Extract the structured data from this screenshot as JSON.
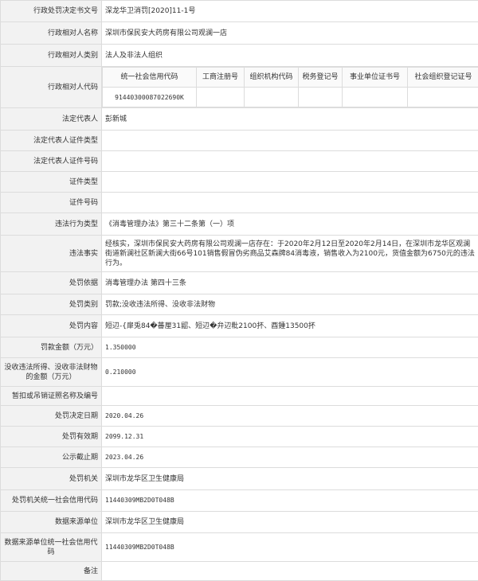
{
  "rows": {
    "decision_no": {
      "label": "行政处罚决定书文号",
      "value": "深龙华卫消罚[2020]11-1号"
    },
    "party_name": {
      "label": "行政相对人名称",
      "value": "深圳市保民安大药房有限公司观澜一店"
    },
    "party_type": {
      "label": "行政相对人类别",
      "value": "法人及非法人组织"
    },
    "party_code": {
      "label": "行政相对人代码",
      "headers": [
        "统一社会信用代码",
        "工商注册号",
        "组织机构代码",
        "税务登记号",
        "事业单位证书号",
        "社会组织登记证号"
      ],
      "values": [
        "91440300087022690K",
        "",
        "",
        "",
        "",
        ""
      ]
    },
    "legal_rep": {
      "label": "法定代表人",
      "value": "彭新城"
    },
    "legal_rep_id_type": {
      "label": "法定代表人证件类型",
      "value": ""
    },
    "legal_rep_id_no": {
      "label": "法定代表人证件号码",
      "value": ""
    },
    "id_type": {
      "label": "证件类型",
      "value": ""
    },
    "id_no": {
      "label": "证件号码",
      "value": ""
    },
    "violation_type": {
      "label": "违法行为类型",
      "value": "《消毒管理办法》第三十二条第（一）项"
    },
    "violation_facts": {
      "label": "违法事实",
      "value": "经核实，深圳市保民安大药房有限公司观澜一店存在：于2020年2月12日至2020年2月14日，在深圳市龙华区观澜街道新澜社区新澜大街66号101销售假冒伪劣商品艾森牌84消毒液，销售收入为2100元，货值金额为6750元的违法行为。"
    },
    "penalty_basis": {
      "label": "处罚依据",
      "value": "消毒管理办法 第四十三条"
    },
    "penalty_category": {
      "label": "处罚类别",
      "value": "罚款;没收违法所得、没收非法财物"
    },
    "penalty_content": {
      "label": "处罚内容",
      "value": "短辺-{肁兎84�蕃厘31鼦、短辺�弁辺粃2100抔、酉鍾13500抔"
    },
    "fine_amount": {
      "label": "罚款金额（万元）",
      "value": "1.350000"
    },
    "confiscation_amount": {
      "label": "没收违法所得、没收非法财物的金额（万元）",
      "value": "0.210000"
    },
    "suspend_license": {
      "label": "暂扣或吊销证照名称及编号",
      "value": ""
    },
    "decision_date": {
      "label": "处罚决定日期",
      "value": "2020.04.26"
    },
    "valid_until": {
      "label": "处罚有效期",
      "value": "2099.12.31"
    },
    "publish_deadline": {
      "label": "公示截止期",
      "value": "2023.04.26"
    },
    "authority": {
      "label": "处罚机关",
      "value": "深圳市龙华区卫生健康局"
    },
    "authority_code": {
      "label": "处罚机关统一社会信用代码",
      "value": "11440309MB2D0T048B"
    },
    "source_unit": {
      "label": "数据来源单位",
      "value": "深圳市龙华区卫生健康局"
    },
    "source_code": {
      "label": "数据来源单位统一社会信用代码",
      "value": "11440309MB2D0T048B"
    },
    "remarks": {
      "label": "备注",
      "value": ""
    }
  }
}
